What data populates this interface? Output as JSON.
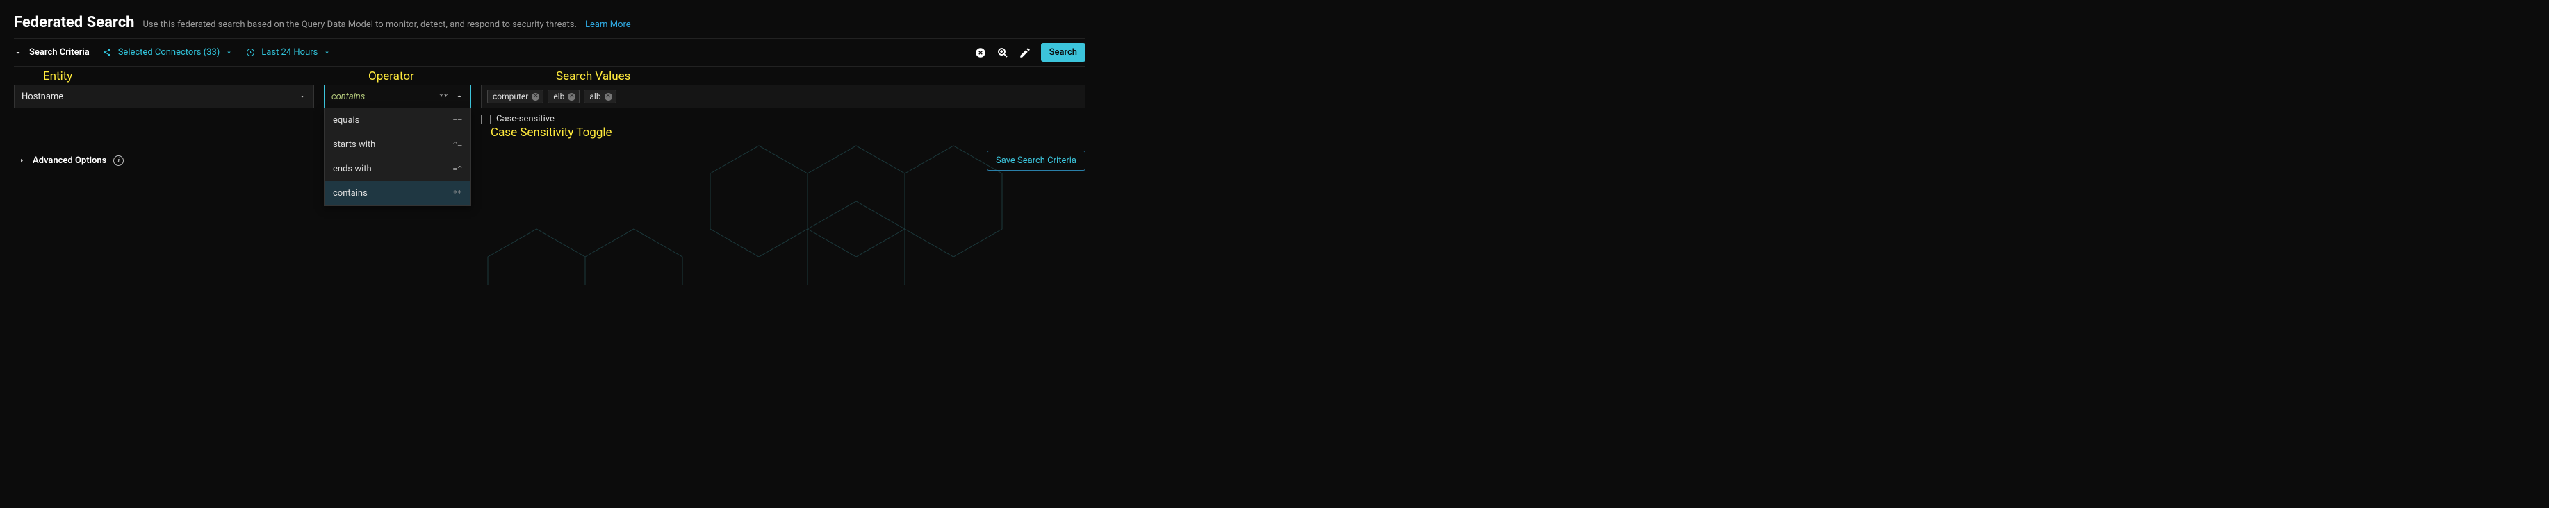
{
  "header": {
    "title": "Federated Search",
    "subtitle": "Use this federated search based on the Query Data Model to monitor, detect, and respond to security threats.",
    "learn_more": "Learn More"
  },
  "toolbar": {
    "search_criteria_label": "Search Criteria",
    "connectors_label": "Selected Connectors (33)",
    "time_label": "Last 24 Hours",
    "search_button": "Search"
  },
  "annotations": {
    "entity": "Entity",
    "operator": "Operator",
    "search_values": "Search Values",
    "case_toggle": "Case Sensitivity Toggle"
  },
  "criteria": {
    "entity_value": "Hostname",
    "operator_value": "contains",
    "operator_symbol": "**",
    "operator_options": [
      {
        "label": "equals",
        "sym": "=="
      },
      {
        "label": "starts with",
        "sym": "^="
      },
      {
        "label": "ends with",
        "sym": "=^"
      },
      {
        "label": "contains",
        "sym": "**"
      }
    ],
    "values": [
      "computer",
      "elb",
      "alb"
    ],
    "case_sensitive_label": "Case-sensitive"
  },
  "advanced": {
    "label": "Advanced Options",
    "save_button": "Save Search Criteria"
  }
}
